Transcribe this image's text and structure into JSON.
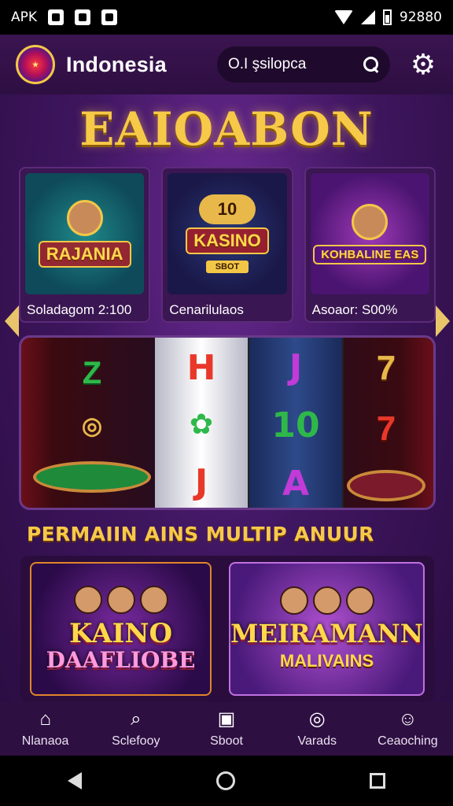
{
  "status_bar": {
    "left_text": "APK",
    "right_text": "92880"
  },
  "header": {
    "brand": "Indonesia",
    "search_text": "O.I şsilopca",
    "logo_icon": "app-logo"
  },
  "hero": {
    "title": "EAIOABON"
  },
  "promos": [
    {
      "caption": "Soladagom 2:100",
      "art_text": "RAJANIA"
    },
    {
      "caption": "Cenarilulaos",
      "art_text": "KASINO",
      "art_number": "10",
      "art_badge": "SBOT"
    },
    {
      "caption": "Asoaor: S00%",
      "art_text": "KOHBALINE EAS"
    }
  ],
  "slot": {
    "reel_1": [
      "H",
      "",
      "J"
    ],
    "reel_2": [
      "J",
      "10",
      "A"
    ],
    "reel_3": [
      "7",
      "7",
      ""
    ],
    "left_symbol": "Z",
    "colors": {
      "green": "#2fb84a",
      "red": "#e8382a",
      "magenta": "#c23ad8"
    }
  },
  "section": {
    "title": "PERMAIIN AINS MULTIP ANUUR"
  },
  "games": [
    {
      "title_line1": "KAINO",
      "title_line2": "DAAFLIOBE"
    },
    {
      "title_line1": "MEIRAMANN",
      "subtitle": "MALIVAINS"
    }
  ],
  "bottom_nav": [
    {
      "label": "Nlanaoa",
      "icon": "home-icon",
      "glyph": "⌂"
    },
    {
      "label": "Sclefooy",
      "icon": "search-icon",
      "glyph": "⌕"
    },
    {
      "label": "Sboot",
      "icon": "wallet-icon",
      "glyph": "▣"
    },
    {
      "label": "Varads",
      "icon": "chat-icon",
      "glyph": "◎"
    },
    {
      "label": "Ceaoching",
      "icon": "profile-icon",
      "glyph": "☺"
    }
  ],
  "accent_color": "#f7c948"
}
